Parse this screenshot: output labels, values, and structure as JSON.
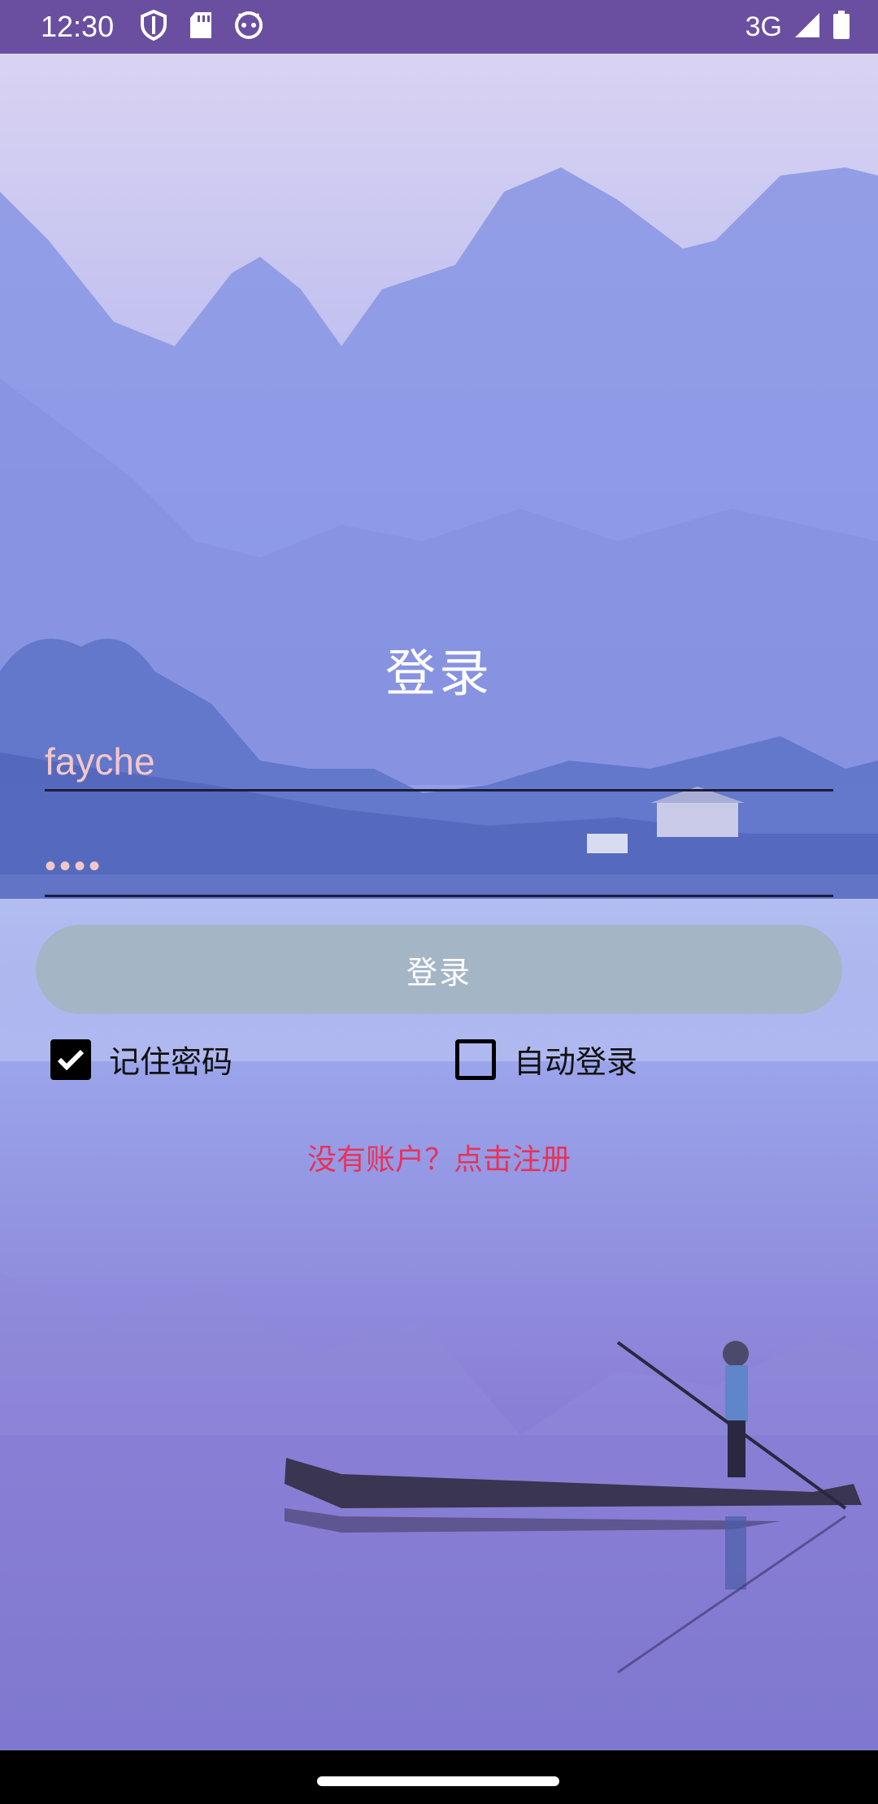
{
  "status_bar": {
    "time": "12:30",
    "network": "3G",
    "icons_left": [
      "shield-icon",
      "sd-card-icon",
      "android-face-icon"
    ],
    "icons_right": [
      "signal-icon",
      "battery-icon"
    ],
    "background_color": "#6a4fa0"
  },
  "login": {
    "title": "登录",
    "username_value": "fayche",
    "password_value": "••••",
    "login_button_label": "登录",
    "button_color": "#a4b5c6",
    "input_text_color": "#f4c7c7"
  },
  "options": {
    "remember_password_label": "记住密码",
    "remember_password_checked": true,
    "auto_login_label": "自动登录",
    "auto_login_checked": false
  },
  "register": {
    "text": "没有账户？点击注册",
    "color": "#e8325a"
  }
}
